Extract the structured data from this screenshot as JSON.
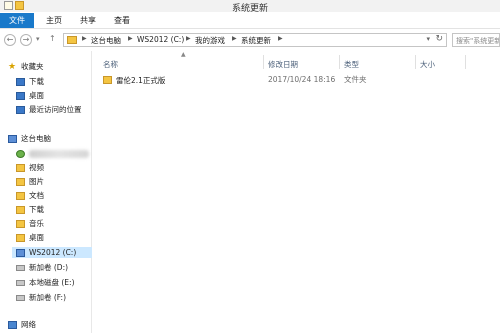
{
  "window": {
    "title": "系统更新"
  },
  "ribbon": {
    "tabs": [
      "文件",
      "主页",
      "共享",
      "查看"
    ]
  },
  "address": {
    "crumbs": [
      "这台电脑",
      "WS2012 (C:)",
      "我的游戏",
      "系统更新"
    ],
    "search_placeholder": "搜索\"系统更新\""
  },
  "sidebar": {
    "favorites": {
      "label": "收藏夹",
      "items": [
        "下载",
        "桌面",
        "最近访问的位置"
      ]
    },
    "this_pc": {
      "label": "这台电脑",
      "items": [
        "视频",
        "图片",
        "文档",
        "下载",
        "音乐",
        "桌面"
      ]
    },
    "drives": [
      "WS2012 (C:)",
      "新加卷 (D:)",
      "本地磁盘 (E:)",
      "新加卷 (F:)"
    ],
    "network": "网络"
  },
  "table": {
    "columns": [
      "名称",
      "修改日期",
      "类型",
      "大小"
    ],
    "rows": [
      {
        "name": "雷伦2.1正式版",
        "modified": "2017/10/24 18:16",
        "type": "文件夹",
        "size": ""
      }
    ]
  }
}
